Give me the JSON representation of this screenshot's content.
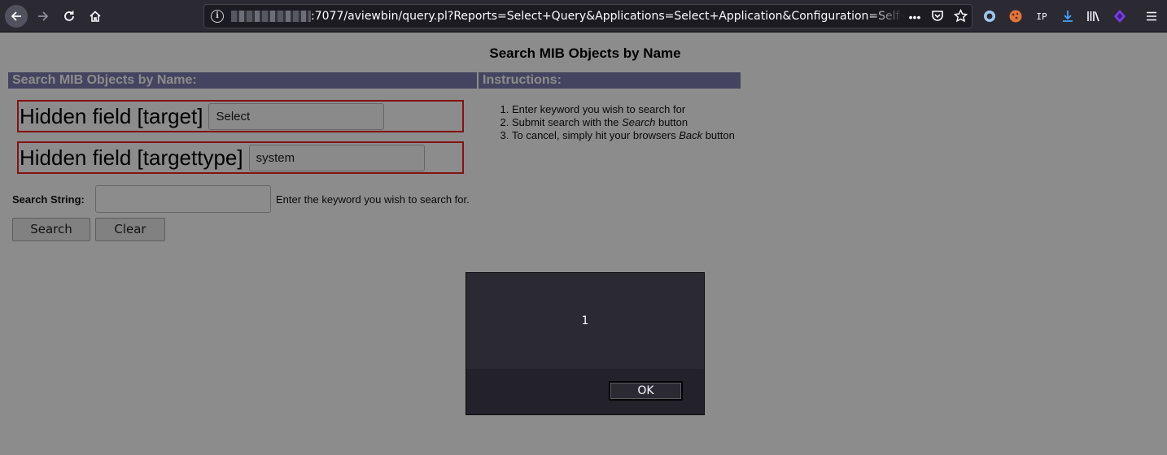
{
  "browser": {
    "url_visible": ":7077/aviewbin/query.pl?Reports=Select+Query&Applications=Select+Application&Configuration=Self+M",
    "icons": [
      "back-icon",
      "forward-icon",
      "reload-icon",
      "home-icon",
      "info-icon",
      "more-icon",
      "pocket-icon",
      "star-icon",
      "extension-circle-icon",
      "cookie-icon",
      "ip-icon",
      "download-icon",
      "library-icon",
      "extension-diamond-icon",
      "menu-icon"
    ],
    "ip_label": "IP"
  },
  "page": {
    "title": "Search MIB Objects by Name",
    "left_header": "Search MIB Objects by Name:",
    "right_header": "Instructions:",
    "hidden_fields": [
      {
        "label": "Hidden field [target]",
        "value": "Select"
      },
      {
        "label": "Hidden field [targettype]",
        "value": "system"
      }
    ],
    "instructions": {
      "step1": "Enter keyword you wish to search for",
      "step2_pre": "Submit search with the ",
      "step2_em": "Search",
      "step2_post": " button",
      "step3_pre": "To cancel, simply hit your browsers ",
      "step3_em": "Back",
      "step3_post": " button"
    },
    "search_label": "Search String:",
    "search_value": "",
    "search_hint": "Enter the keyword you wish to search for.",
    "search_button": "Search",
    "clear_button": "Clear"
  },
  "dialog": {
    "message": "1",
    "ok_label": "OK"
  }
}
